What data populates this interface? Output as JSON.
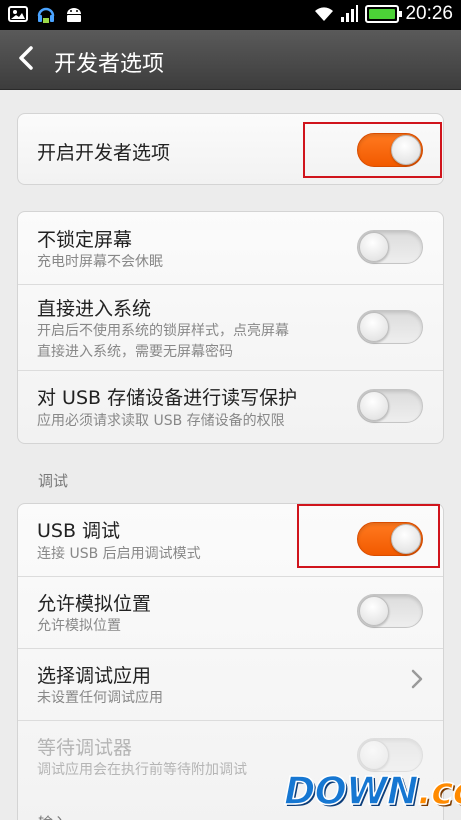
{
  "status_bar": {
    "time": "20:26",
    "left_icons": [
      "image-icon",
      "headset-icon",
      "android-icon"
    ],
    "right_icons": [
      "wifi-icon",
      "signal-icon",
      "battery-icon"
    ]
  },
  "header": {
    "title": "开发者选项",
    "back_icon": "chevron-left-icon"
  },
  "groups": {
    "main": {
      "title": "开启开发者选项",
      "toggle_on": true
    },
    "lock": {
      "items": [
        {
          "title": "不锁定屏幕",
          "subtitle": "充电时屏幕不会休眠",
          "toggle_on": false
        },
        {
          "title": "直接进入系统",
          "subtitle_line1": "开启后不使用系统的锁屏样式，点亮屏幕",
          "subtitle_line2": "直接进入系统，需要无屏幕密码",
          "toggle_on": false
        },
        {
          "title": "对 USB 存储设备进行读写保护",
          "subtitle": "应用必须请求读取 USB 存储设备的权限",
          "toggle_on": false
        }
      ]
    },
    "debug": {
      "section_label": "调试",
      "items": [
        {
          "title": "USB 调试",
          "subtitle": "连接 USB 后启用调试模式",
          "toggle_on": true
        },
        {
          "title": "允许模拟位置",
          "subtitle": "允许模拟位置",
          "toggle_on": false
        },
        {
          "title": "选择调试应用",
          "subtitle": "未设置任何调试应用",
          "chevron_icon": "chevron-right-icon"
        },
        {
          "title": "等待调试器",
          "subtitle": "调试应用会在执行前等待附加调试",
          "toggle_on": false,
          "disabled": true
        }
      ]
    },
    "next_section_label": "输入"
  },
  "watermark": {
    "main": "DOWN",
    "suffix": ".cc"
  },
  "colors": {
    "toggle_on": "#f25a00",
    "highlight_box": "#d0141c",
    "title_bar": "#4a4a4a"
  }
}
